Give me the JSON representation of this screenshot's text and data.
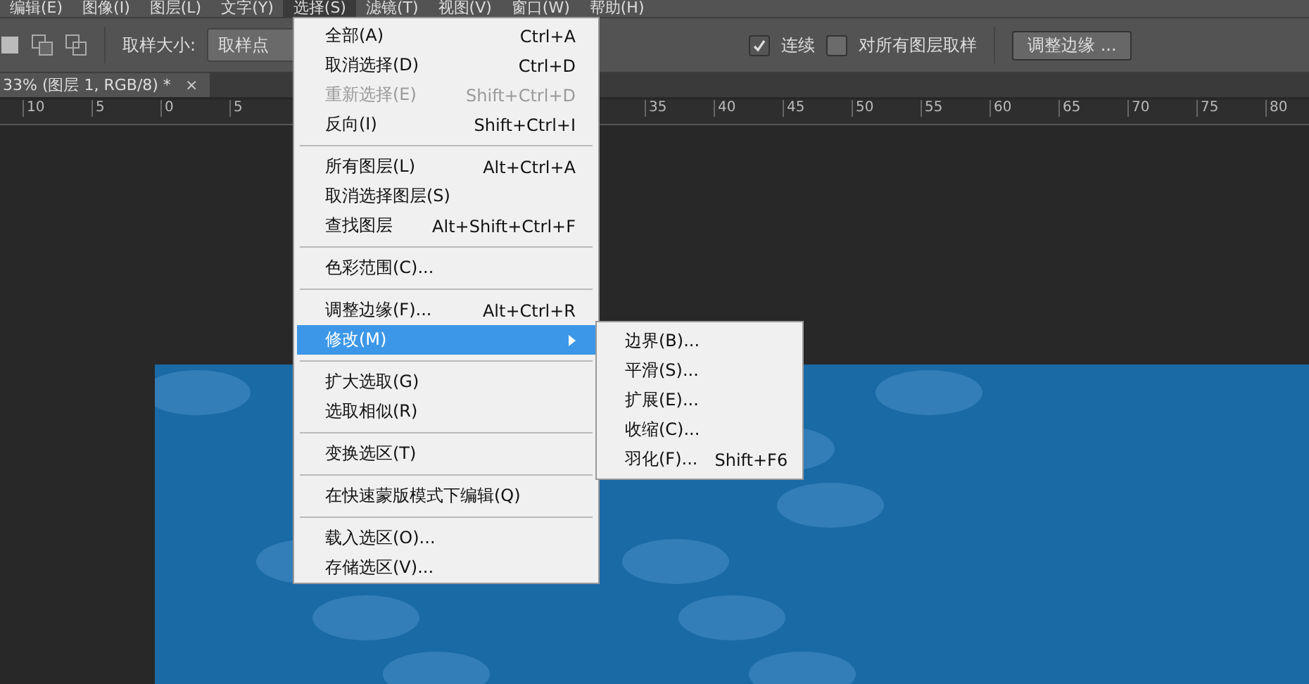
{
  "menu_bar": [
    {
      "label": "编辑(E)",
      "selected": false
    },
    {
      "label": "图像(I)",
      "selected": false
    },
    {
      "label": "图层(L)",
      "selected": false
    },
    {
      "label": "文字(Y)",
      "selected": false
    },
    {
      "label": "选择(S)",
      "selected": true
    },
    {
      "label": "滤镜(T)",
      "selected": false
    },
    {
      "label": "视图(V)",
      "selected": false
    },
    {
      "label": "窗口(W)",
      "selected": false
    },
    {
      "label": "帮助(H)",
      "selected": false
    }
  ],
  "options_bar": {
    "sample_size_label": "取样大小:",
    "sample_size_value": "取样点",
    "contiguous": {
      "label": "连续",
      "checked": true
    },
    "sample_all_layers": {
      "label": "对所有图层取样",
      "checked": false
    },
    "refine_edge_button": "调整边缘 ..."
  },
  "document_tab": {
    "title": "33% (图层 1, RGB/8) *",
    "close": "×"
  },
  "ruler": {
    "left_labels": [
      "10",
      "5",
      "0",
      "5"
    ],
    "right_labels": [
      "35",
      "40",
      "45",
      "50",
      "55",
      "60",
      "65",
      "70",
      "75",
      "80"
    ]
  },
  "select_menu": [
    {
      "kind": "item",
      "label": "全部(A)",
      "shortcut": "Ctrl+A",
      "disabled": false,
      "selected": false
    },
    {
      "kind": "item",
      "label": "取消选择(D)",
      "shortcut": "Ctrl+D",
      "disabled": false,
      "selected": false
    },
    {
      "kind": "item",
      "label": "重新选择(E)",
      "shortcut": "Shift+Ctrl+D",
      "disabled": true,
      "selected": false
    },
    {
      "kind": "item",
      "label": "反向(I)",
      "shortcut": "Shift+Ctrl+I",
      "disabled": false,
      "selected": false
    },
    {
      "kind": "separator"
    },
    {
      "kind": "item",
      "label": "所有图层(L)",
      "shortcut": "Alt+Ctrl+A",
      "disabled": false,
      "selected": false
    },
    {
      "kind": "item",
      "label": "取消选择图层(S)",
      "disabled": false,
      "selected": false
    },
    {
      "kind": "item",
      "label": "查找图层",
      "shortcut": "Alt+Shift+Ctrl+F",
      "disabled": false,
      "selected": false
    },
    {
      "kind": "separator"
    },
    {
      "kind": "item",
      "label": "色彩范围(C)...",
      "disabled": false,
      "selected": false
    },
    {
      "kind": "separator"
    },
    {
      "kind": "item",
      "label": "调整边缘(F)...",
      "shortcut": "Alt+Ctrl+R",
      "disabled": false,
      "selected": false
    },
    {
      "kind": "submenu",
      "label": "修改(M)",
      "disabled": false,
      "selected": true
    },
    {
      "kind": "separator"
    },
    {
      "kind": "item",
      "label": "扩大选取(G)",
      "disabled": false,
      "selected": false
    },
    {
      "kind": "item",
      "label": "选取相似(R)",
      "disabled": false,
      "selected": false
    },
    {
      "kind": "separator"
    },
    {
      "kind": "item",
      "label": "变换选区(T)",
      "disabled": false,
      "selected": false
    },
    {
      "kind": "separator"
    },
    {
      "kind": "item",
      "label": "在快速蒙版模式下编辑(Q)",
      "disabled": false,
      "selected": false
    },
    {
      "kind": "separator"
    },
    {
      "kind": "item",
      "label": "载入选区(O)...",
      "disabled": false,
      "selected": false
    },
    {
      "kind": "item",
      "label": "存储选区(V)...",
      "disabled": false,
      "selected": false
    }
  ],
  "modify_submenu": [
    {
      "label": "边界(B)..."
    },
    {
      "label": "平滑(S)..."
    },
    {
      "label": "扩展(E)..."
    },
    {
      "label": "收缩(C)..."
    },
    {
      "label": "羽化(F)...",
      "shortcut": "Shift+F6"
    }
  ]
}
